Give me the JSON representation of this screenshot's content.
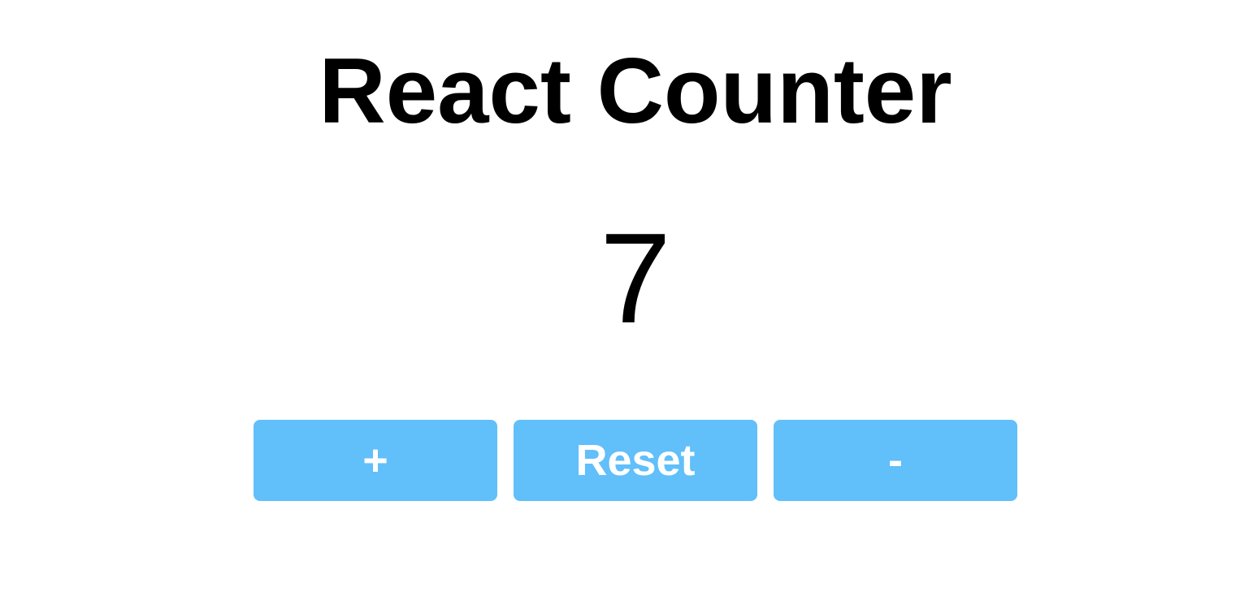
{
  "title": "React Counter",
  "count": "7",
  "buttons": {
    "increment": "+",
    "reset": "Reset",
    "decrement": "-"
  },
  "colors": {
    "button_bg": "#61bffa",
    "button_text": "#ffffff"
  }
}
